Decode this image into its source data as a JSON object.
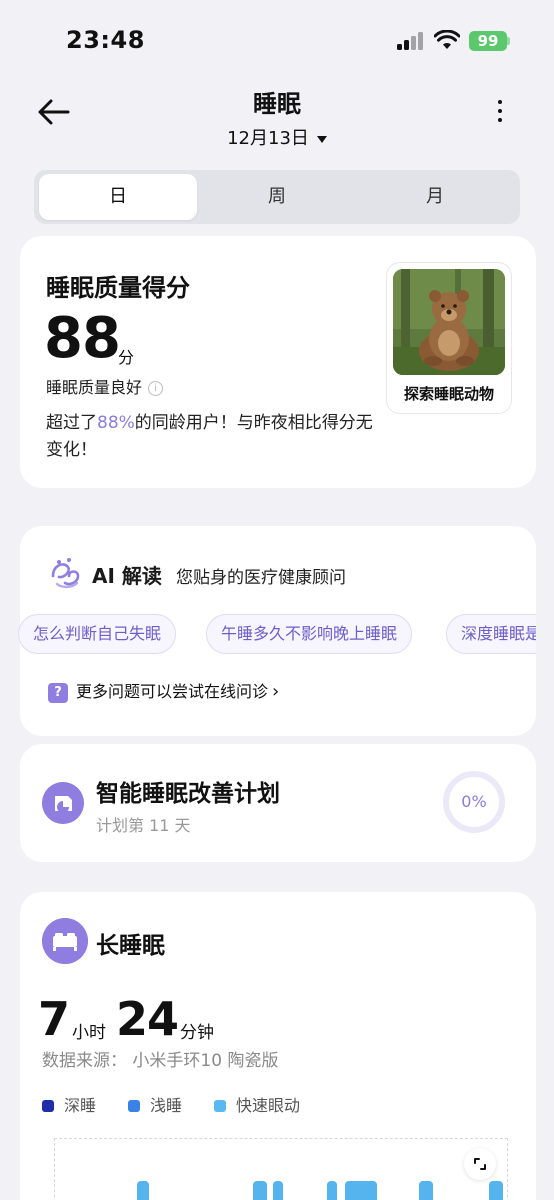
{
  "status_bar": {
    "time": "23:48",
    "battery": "99"
  },
  "header": {
    "title": "睡眠",
    "date": "12月13日"
  },
  "tabs": [
    {
      "label": "日",
      "active": true
    },
    {
      "label": "周",
      "active": false
    },
    {
      "label": "月",
      "active": false
    }
  ],
  "score_card": {
    "title": "睡眠质量得分",
    "score": "88",
    "unit": "分",
    "level": "睡眠质量良好",
    "desc_prefix": "超过了",
    "desc_percent": "88%",
    "desc_suffix": "的同龄用户！与昨夜相比得分无变化！",
    "animal_label": "探索睡眠动物"
  },
  "ai_card": {
    "title": "AI 解读",
    "subtitle": "您贴身的医疗健康顾问",
    "chips": [
      "怎么判断自己失眠",
      "午睡多久不影响晚上睡眠",
      "深度睡眠是"
    ],
    "more_icon": "?",
    "more_label": "更多问题可以尝试在线问诊"
  },
  "plan_card": {
    "title": "智能睡眠改善计划",
    "day_text": "计划第 11 天",
    "progress_label": "0%",
    "progress": 0
  },
  "long_sleep": {
    "title": "长睡眠",
    "hours": "7",
    "hours_unit": "小时",
    "minutes": "24",
    "minutes_unit": "分钟",
    "source": "数据来源： 小米手环10 陶瓷版",
    "legend": [
      {
        "label": "深睡",
        "color": "#1f2ea8"
      },
      {
        "label": "浅睡",
        "color": "#3b82e8"
      },
      {
        "label": "快速眼动",
        "color": "#5ab9f0"
      }
    ]
  },
  "colors": {
    "accent": "#8f7ee0",
    "accent_text": "#8b7cd6",
    "chip_text": "#6e5fc8"
  }
}
